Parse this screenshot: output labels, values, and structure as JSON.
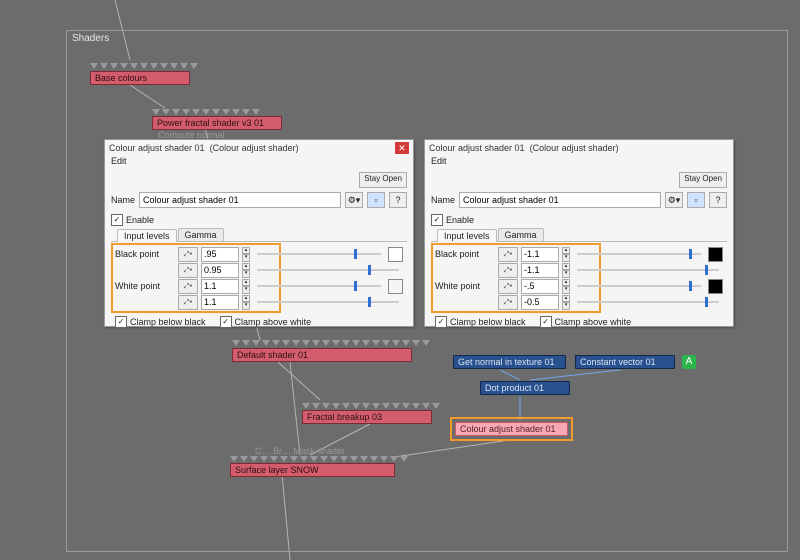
{
  "outer_label": "Shaders",
  "nodes": {
    "base_colours": "Base colours",
    "power_fractal": "Power fractal shader v3 01",
    "default_shader": "Default shader 01",
    "fractal_breakup": "Fractal breakup 03",
    "surface_layer": "Surface layer SNOW",
    "get_normal": "Get normal in texture 01",
    "constant_vector": "Constant vector 01",
    "dot_product": "Dot product 01",
    "colour_adjust": "Colour adjust shader 01"
  },
  "faint_labels": {
    "compute_normal": "Compute normal",
    "mask_shader": "C…  Br…  Mask shader"
  },
  "marker_a": "A",
  "panel_left": {
    "title_name": "Colour adjust shader 01",
    "title_type": "(Colour adjust shader)",
    "menu_edit": "Edit",
    "stay_open": "Stay Open",
    "name_label": "Name",
    "name_value": "Colour adjust shader 01",
    "gear": "⚙▾",
    "doc": "▫",
    "help": "?",
    "enable": "Enable",
    "tab_levels": "Input levels",
    "tab_gamma": "Gamma",
    "black_point": "Black point",
    "white_point": "White point",
    "vals": {
      "bp1": ".95",
      "bp2": "0.95",
      "wp1": "1.1",
      "wp2": "1.1"
    },
    "thumb_pos": "78%",
    "swatch": "#ffffff",
    "clamp_below": "Clamp below black",
    "clamp_above": "Clamp above white"
  },
  "panel_right": {
    "title_name": "Colour adjust shader 01",
    "title_type": "(Colour adjust shader)",
    "menu_edit": "Edit",
    "stay_open": "Stay Open",
    "name_label": "Name",
    "name_value": "Colour adjust shader 01",
    "gear": "⚙▾",
    "doc": "▫",
    "help": "?",
    "enable": "Enable",
    "tab_levels": "Input levels",
    "tab_gamma": "Gamma",
    "black_point": "Black point",
    "white_point": "White point",
    "vals": {
      "bp1": "-1.1",
      "bp2": "-1.1",
      "wp1": "-.5",
      "wp2": "-0.5"
    },
    "thumb_pos": "90%",
    "swatch": "#000000",
    "clamp_below": "Clamp below black",
    "clamp_above": "Clamp above white"
  }
}
